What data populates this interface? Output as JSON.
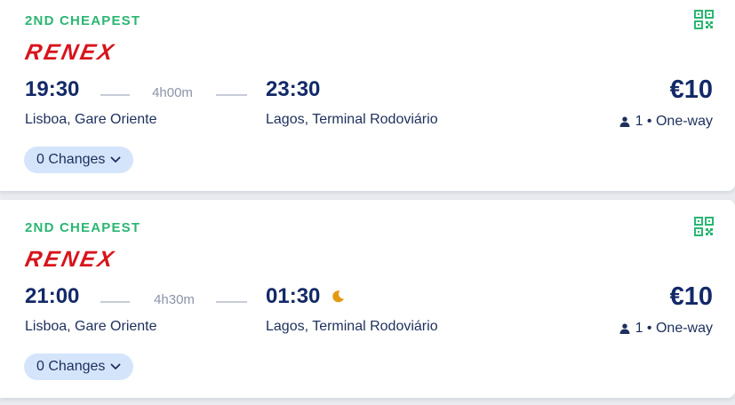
{
  "colors": {
    "accent_green": "#2bb673",
    "navy": "#132968",
    "logo_red": "#d8141c",
    "chip_bg": "#d4e5fb",
    "moon": "#e39a12"
  },
  "icons": {
    "qr": "qr-code-icon",
    "passenger": "person-icon",
    "chevron": "chevron-down-icon",
    "night": "moon-icon"
  },
  "trips": [
    {
      "badge": "2ND CHEAPEST",
      "operator": "RENEX",
      "departure_time": "19:30",
      "duration": "4h00m",
      "arrival_time": "23:30",
      "overnight": false,
      "departure_station": "Lisboa, Gare Oriente",
      "arrival_station": "Lagos, Terminal Rodoviário",
      "price": "€10",
      "passengers": "1 • One-way",
      "changes": "0 Changes"
    },
    {
      "badge": "2ND CHEAPEST",
      "operator": "RENEX",
      "departure_time": "21:00",
      "duration": "4h30m",
      "arrival_time": "01:30",
      "overnight": true,
      "departure_station": "Lisboa, Gare Oriente",
      "arrival_station": "Lagos, Terminal Rodoviário",
      "price": "€10",
      "passengers": "1 • One-way",
      "changes": "0 Changes"
    }
  ]
}
